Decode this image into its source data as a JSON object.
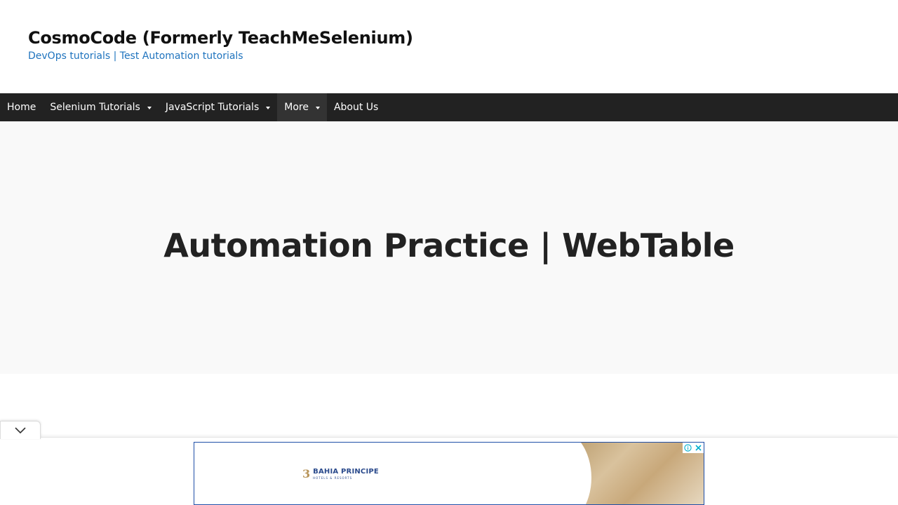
{
  "header": {
    "site_title": "CosmoCode (Formerly TeachMeSelenium)",
    "tagline": "DevOps tutorials | Test Automation tutorials"
  },
  "nav": {
    "items": [
      {
        "label": "Home",
        "has_dropdown": false
      },
      {
        "label": "Selenium Tutorials",
        "has_dropdown": true
      },
      {
        "label": "JavaScript Tutorials",
        "has_dropdown": true
      },
      {
        "label": "More",
        "has_dropdown": true,
        "active": true
      },
      {
        "label": "About Us",
        "has_dropdown": false
      }
    ]
  },
  "hero": {
    "title": "Automation Practice | WebTable"
  },
  "ad": {
    "brand_mark": "3",
    "brand_name": "BAHIA PRINCIPE",
    "brand_sub": "HOTELS & RESORTS",
    "info_icon": "info-icon",
    "close_icon": "close-icon",
    "accent_color": "#00aecd"
  },
  "colors": {
    "nav_bg": "#222222",
    "tagline": "#1e73be",
    "hero_bg": "#f9f9f9"
  }
}
